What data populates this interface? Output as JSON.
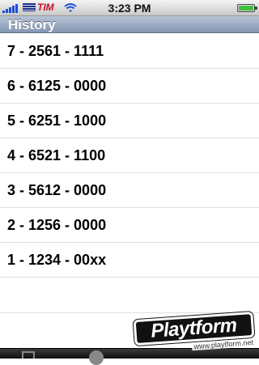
{
  "status_bar": {
    "carrier": "TIM",
    "time": "3:23 PM"
  },
  "nav": {
    "title": "History"
  },
  "history": [
    "7 - 2561 - 1111",
    "6 - 6125 - 0000",
    "5 - 6251 - 1000",
    "4 - 6521 - 1100",
    "3 - 5612 - 0000",
    "2 - 1256 - 0000",
    "1 - 1234 - 00xx"
  ],
  "watermark": {
    "brand": "Playtform",
    "url": "www.playtform.net"
  },
  "icons": {
    "signal": "signal-bars-icon",
    "wifi": "wifi-icon",
    "battery": "battery-icon"
  },
  "colors": {
    "nav_bar": "#8396b2",
    "battery_fill": "#3fbf3f"
  }
}
